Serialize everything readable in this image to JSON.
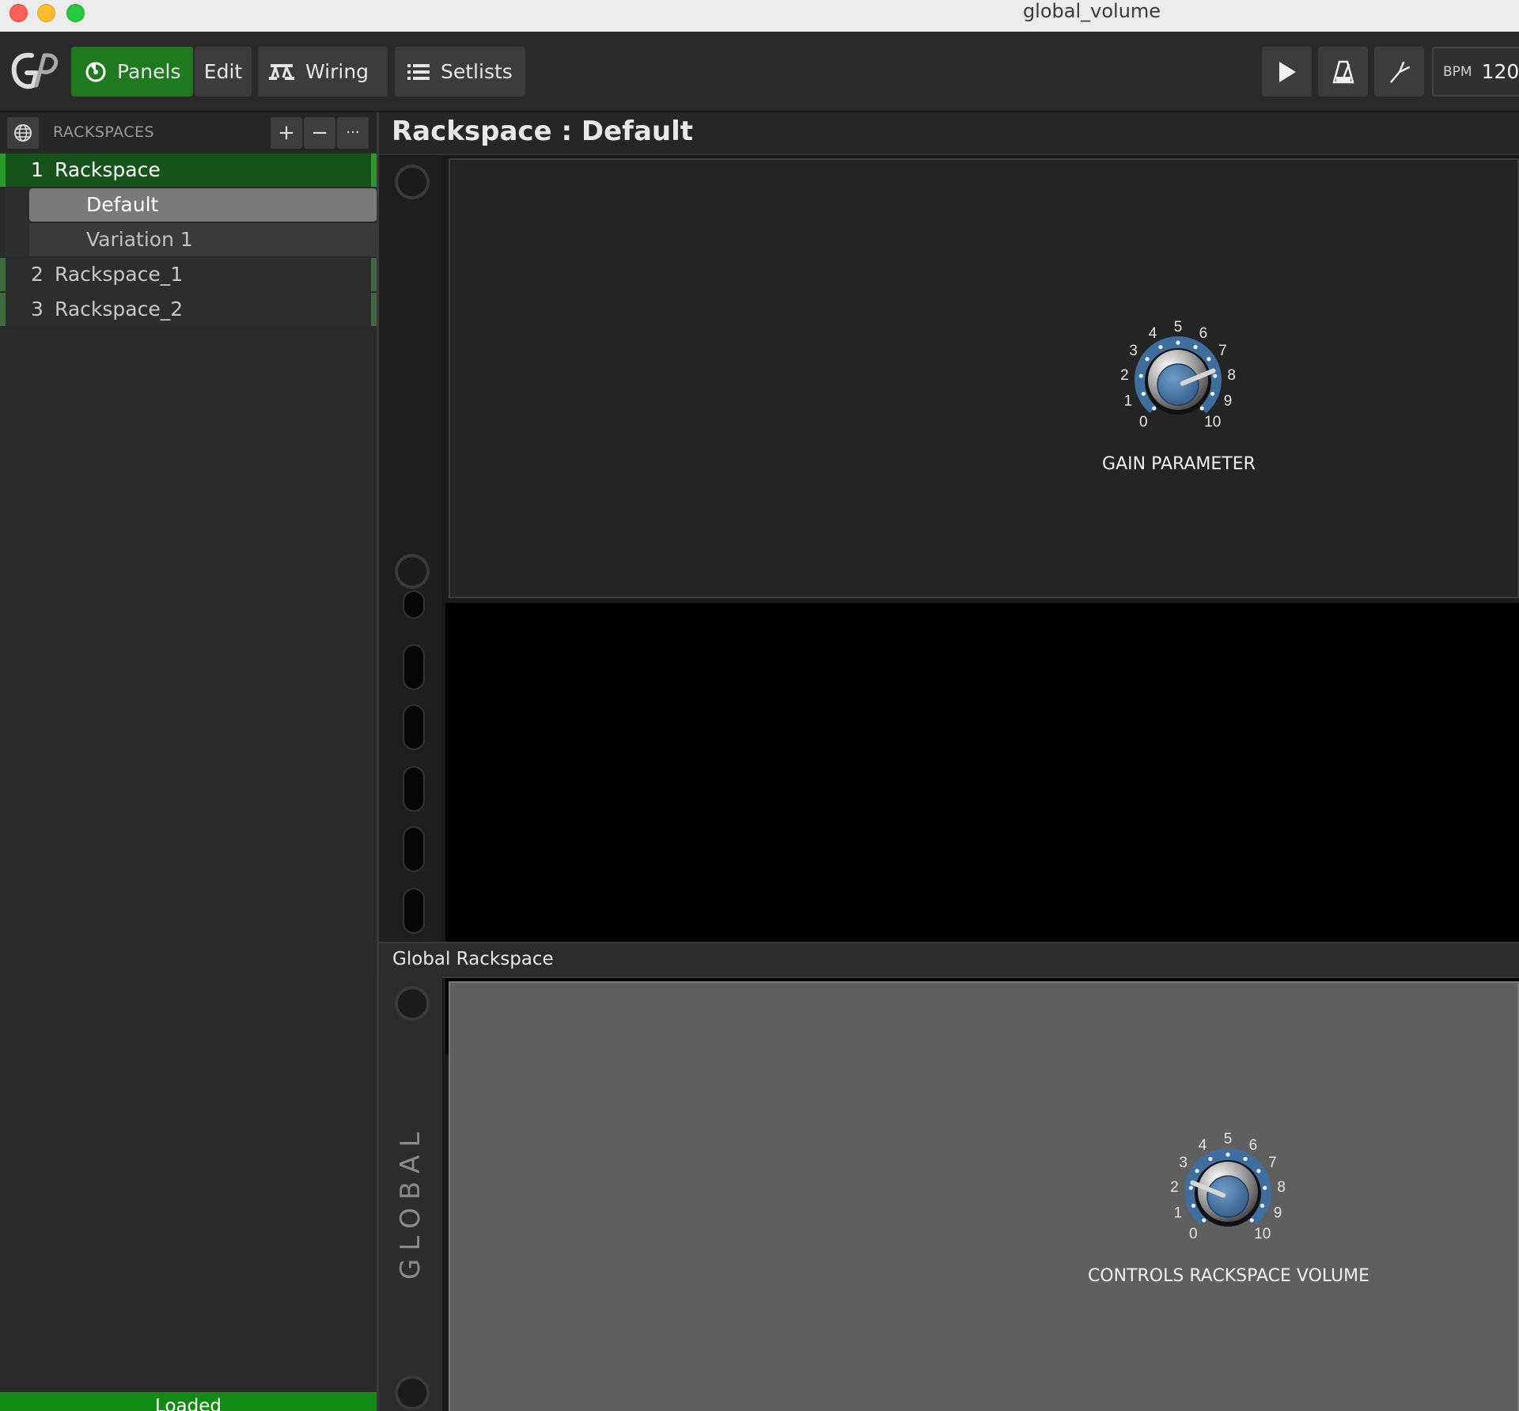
{
  "window": {
    "title": "global_volume"
  },
  "toolbar": {
    "panels_label": "Panels",
    "edit_label": "Edit",
    "wiring_label": "Wiring",
    "setlists_label": "Setlists",
    "bpm_label": "BPM",
    "bpm_value": "120."
  },
  "sidebar": {
    "header": "RACKSPACES",
    "add": "+",
    "remove": "−",
    "more": "···",
    "rackspaces": [
      {
        "num": "1",
        "name": "Rackspace"
      },
      {
        "num": "2",
        "name": "Rackspace_1"
      },
      {
        "num": "3",
        "name": "Rackspace_2"
      }
    ],
    "variations": [
      "Default",
      "Variation 1"
    ],
    "status": "Loaded"
  },
  "main": {
    "rackspace_title": "Rackspace : Default",
    "global_title": "Global Rackspace",
    "global_rail_label": "GLOBAL"
  },
  "knobs": {
    "scale": [
      "0",
      "1",
      "2",
      "3",
      "4",
      "5",
      "6",
      "7",
      "8",
      "9",
      "10"
    ],
    "gain": {
      "label": "GAIN PARAMETER",
      "value": 7.7
    },
    "volume": {
      "label": "CONTROLS RACKSPACE VOLUME",
      "value": 2.3
    }
  },
  "colors": {
    "accent_green": "#1a8a1a",
    "knob_blue": "#3f6d9e"
  }
}
